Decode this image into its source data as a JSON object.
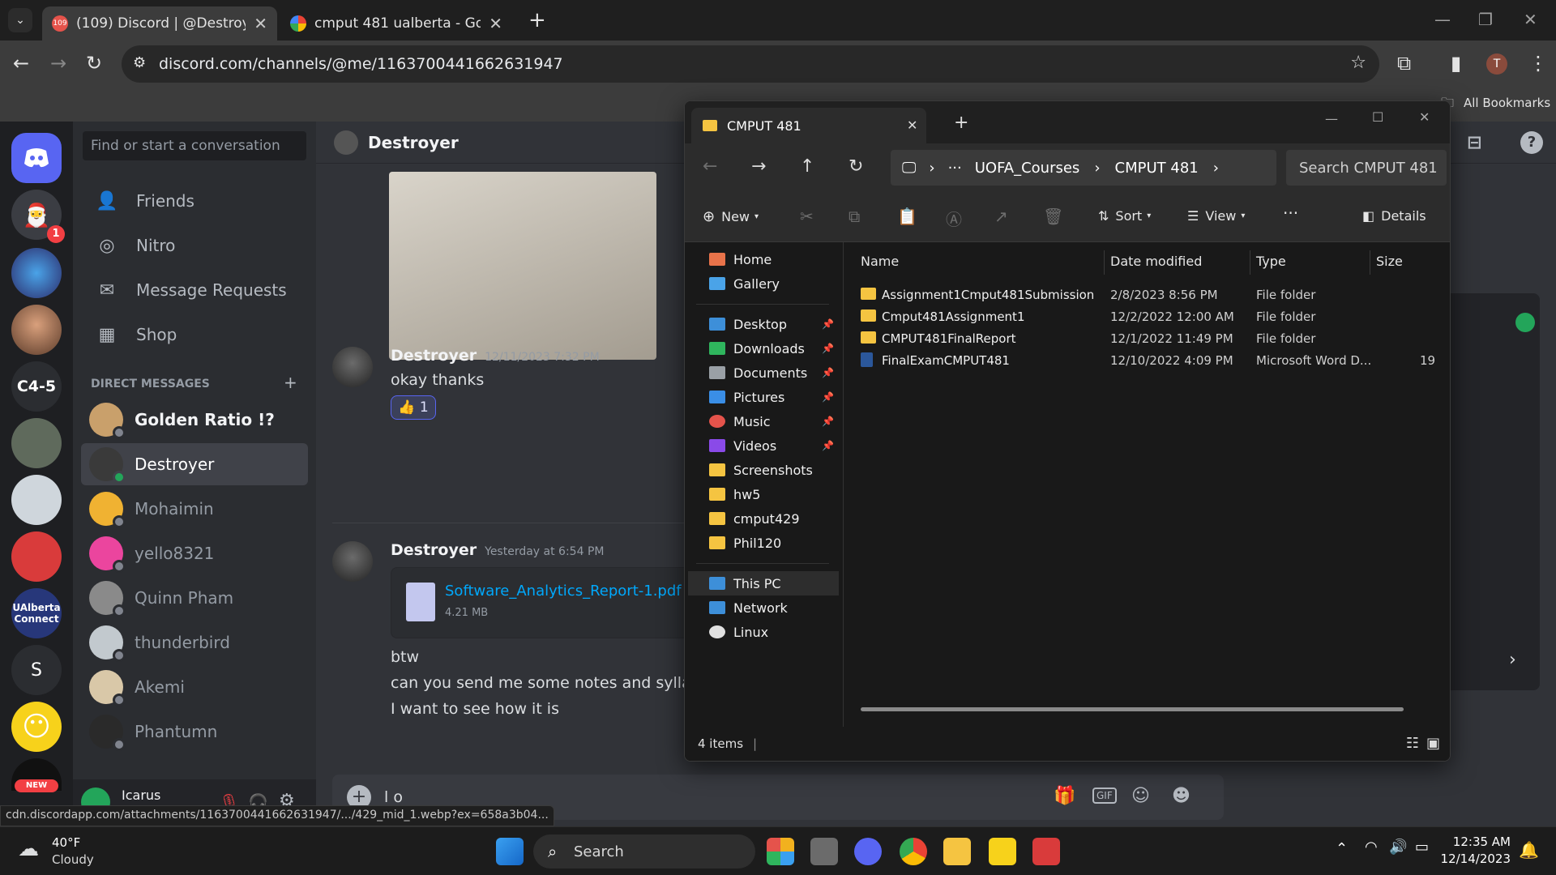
{
  "browser": {
    "tabs": [
      {
        "title": "(109) Discord | @Destroyer",
        "badge": "109",
        "active": true
      },
      {
        "title": "cmput 481 ualberta - Google Sc",
        "active": false
      }
    ],
    "url": "discord.com/channels/@me/1163700441662631947",
    "bookmarks_label": "All Bookmarks",
    "profile_initial": "T",
    "status_url": "cdn.discordapp.com/attachments/1163700441662631947/.../429_mid_1.webp?ex=658a3b04..."
  },
  "discord": {
    "servers": [
      {
        "label": "",
        "badge": ""
      },
      {
        "label": "",
        "badge": "1"
      },
      {
        "label": "",
        "badge": ""
      },
      {
        "label": "",
        "badge": ""
      },
      {
        "label": "C4-5",
        "badge": ""
      },
      {
        "label": "",
        "badge": ""
      },
      {
        "label": "",
        "badge": ""
      },
      {
        "label": "",
        "badge": ""
      },
      {
        "label": "UAlberta Connect",
        "badge": ""
      },
      {
        "label": "S",
        "badge": ""
      },
      {
        "label": "",
        "badge": ""
      },
      {
        "label": "NEW",
        "badge": ""
      }
    ],
    "search_placeholder": "Find or start a conversation",
    "nav": [
      {
        "label": "Friends"
      },
      {
        "label": "Nitro"
      },
      {
        "label": "Message Requests"
      },
      {
        "label": "Shop"
      }
    ],
    "direct_messages_label": "DIRECT MESSAGES",
    "add_dm_symbol": "+",
    "dms": [
      {
        "name": "Golden Ratio !?",
        "color": "#c9a06b"
      },
      {
        "name": "Destroyer",
        "color": "#3a3a3a",
        "selected": true
      },
      {
        "name": "Mohaimin",
        "color": "#f0b232"
      },
      {
        "name": "yello8321",
        "color": "#eb459e"
      },
      {
        "name": "Quinn Pham",
        "color": "#8a8a8a"
      },
      {
        "name": "thunderbird",
        "color": "#c2c9ce"
      },
      {
        "name": "Akemi",
        "color": "#d9c8a8"
      },
      {
        "name": "Phantumn",
        "color": "#2a2a2a"
      }
    ],
    "user": {
      "name": "Icarus"
    },
    "chat": {
      "header_name": "Destroyer",
      "messages": [
        {
          "author": "Destroyer",
          "time": "12/11/2023 7:32 PM",
          "text": "okay thanks",
          "reaction_emoji": "👍",
          "reaction_count": "1"
        },
        {
          "author": "Destroyer",
          "time": "Yesterday at 6:54 PM",
          "attachment_name": "Software_Analytics_Report-1.pdf",
          "attachment_size": "4.21 MB",
          "lines": [
            "btw",
            "can you send me some notes and syllabus f",
            "I want to see how it is"
          ]
        }
      ],
      "composer_text": "l o"
    }
  },
  "explorer": {
    "tab_title": "CMPUT 481",
    "new_tab_symbol": "+",
    "breadcrumb": [
      "UOFA_Courses",
      "CMPUT 481"
    ],
    "search_placeholder": "Search CMPUT 481",
    "commands": {
      "new": "New",
      "sort": "Sort",
      "view": "View",
      "details": "Details"
    },
    "sidebar": [
      {
        "label": "Home",
        "color": "#e8734a"
      },
      {
        "label": "Gallery",
        "color": "#4aa3e8"
      },
      {
        "label": "Desktop",
        "color": "#3d8fd9",
        "pinned": true
      },
      {
        "label": "Downloads",
        "color": "#2fb55d",
        "pinned": true
      },
      {
        "label": "Documents",
        "color": "#9aa0a6",
        "pinned": true
      },
      {
        "label": "Pictures",
        "color": "#3a8ee6",
        "pinned": true
      },
      {
        "label": "Music",
        "color": "#e5534b",
        "pinned": true
      },
      {
        "label": "Videos",
        "color": "#8a4ae8",
        "pinned": true
      },
      {
        "label": "Screenshots",
        "color": "#f5c441"
      },
      {
        "label": "hw5",
        "color": "#f5c441"
      },
      {
        "label": "cmput429",
        "color": "#f5c441"
      },
      {
        "label": "Phil120",
        "color": "#f5c441"
      },
      {
        "label": "This PC",
        "color": "#3d8fd9",
        "selected": true
      },
      {
        "label": "Network",
        "color": "#3d8fd9"
      },
      {
        "label": "Linux",
        "color": "#e0e0e0"
      }
    ],
    "columns": [
      "Name",
      "Date modified",
      "Type",
      "Size"
    ],
    "files": [
      {
        "name": "Assignment1Cmput481Submission",
        "date": "2/8/2023 8:56 PM",
        "type": "File folder",
        "size": "",
        "kind": "folder"
      },
      {
        "name": "Cmput481Assignment1",
        "date": "12/2/2022 12:00 AM",
        "type": "File folder",
        "size": "",
        "kind": "folder"
      },
      {
        "name": "CMPUT481FinalReport",
        "date": "12/1/2022 11:49 PM",
        "type": "File folder",
        "size": "",
        "kind": "folder"
      },
      {
        "name": "FinalExamCMPUT481",
        "date": "12/10/2022 4:09 PM",
        "type": "Microsoft Word D...",
        "size": "19",
        "kind": "word"
      }
    ],
    "status": "4 items"
  },
  "taskbar": {
    "weather_temp": "40°F",
    "weather_desc": "Cloudy",
    "search_label": "Search",
    "time": "12:35 AM",
    "date": "12/14/2023"
  }
}
